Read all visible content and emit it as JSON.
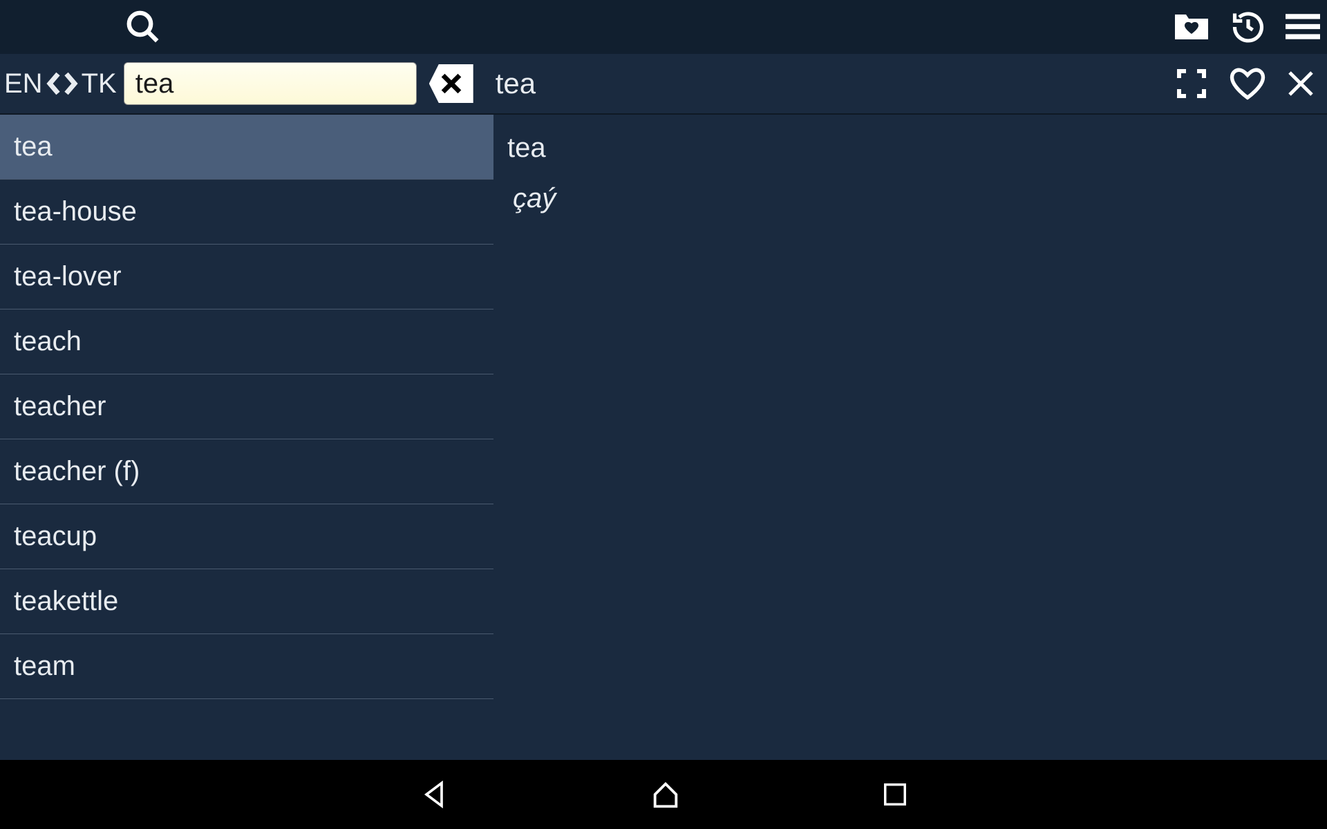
{
  "toolbar": {
    "source_lang": "EN",
    "target_lang": "TK"
  },
  "search": {
    "value": "tea"
  },
  "headword": "tea",
  "word_list": [
    {
      "label": "tea",
      "selected": true
    },
    {
      "label": "tea-house",
      "selected": false
    },
    {
      "label": "tea-lover",
      "selected": false
    },
    {
      "label": "teach",
      "selected": false
    },
    {
      "label": "teacher",
      "selected": false
    },
    {
      "label": "teacher (f)",
      "selected": false
    },
    {
      "label": "teacup",
      "selected": false
    },
    {
      "label": "teakettle",
      "selected": false
    },
    {
      "label": "team",
      "selected": false
    }
  ],
  "definition": {
    "word": "tea",
    "translation": "çaý"
  }
}
